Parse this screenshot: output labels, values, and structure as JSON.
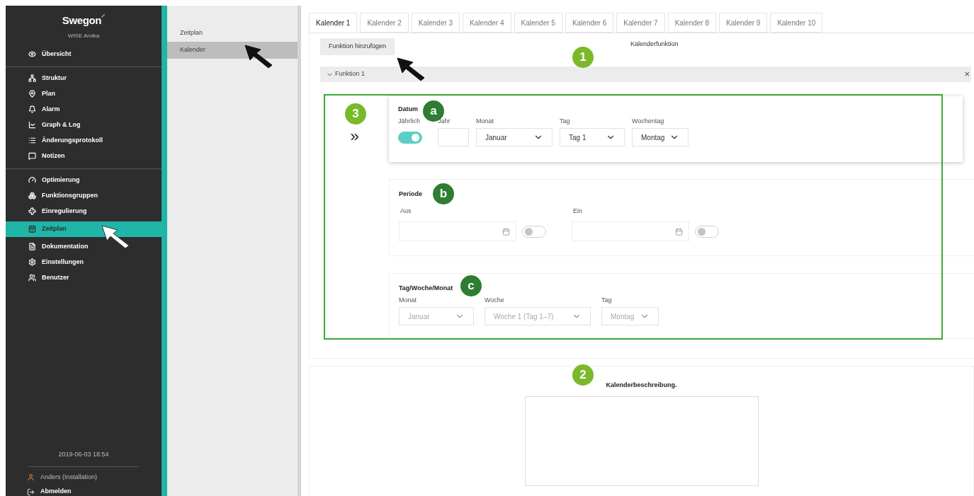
{
  "sidebar": {
    "logo": "Swegon",
    "subtitle": "WISE Arvika",
    "groups": [
      [
        {
          "label": "Übersicht",
          "selected": false
        }
      ],
      [
        {
          "label": "Struktur",
          "selected": false
        },
        {
          "label": "Plan",
          "selected": false
        },
        {
          "label": "Alarm",
          "selected": false
        },
        {
          "label": "Graph & Log",
          "selected": false
        },
        {
          "label": "Änderungsprotokoll",
          "selected": false
        },
        {
          "label": "Notizen",
          "selected": false
        }
      ],
      [
        {
          "label": "Optimierung",
          "selected": false
        },
        {
          "label": "Funktionsgruppen",
          "selected": false
        },
        {
          "label": "Einregulierung",
          "selected": false
        },
        {
          "label": "Zeitplan",
          "selected": true
        },
        {
          "label": "Dokumentation",
          "selected": false
        },
        {
          "label": "Einstellungen",
          "selected": false
        },
        {
          "label": "Benutzer",
          "selected": false
        }
      ]
    ],
    "timestamp": "2019-06-03 18:54",
    "user": "Anders (Installation)",
    "logout": "Abmelden"
  },
  "submenu": [
    {
      "label": "Zeitplan",
      "selected": false
    },
    {
      "label": "Kalender",
      "selected": true
    }
  ],
  "tabs": [
    {
      "label": "Kalender 1",
      "selected": true
    },
    {
      "label": "Kalender 2",
      "selected": false
    },
    {
      "label": "Kalender 3",
      "selected": false
    },
    {
      "label": "Kalender 4",
      "selected": false
    },
    {
      "label": "Kalender 5",
      "selected": false
    },
    {
      "label": "Kalender 6",
      "selected": false
    },
    {
      "label": "Kalender 7",
      "selected": false
    },
    {
      "label": "Kalender 8",
      "selected": false
    },
    {
      "label": "Kalender 9",
      "selected": false
    },
    {
      "label": "Kalender 10",
      "selected": false
    }
  ],
  "add_function_button": "Funktion hinzufügen",
  "section_title": "Kalenderfunktion",
  "function_panel": {
    "title": "Funktion 1",
    "expanded": true,
    "close": "×",
    "expand_marker": "»",
    "datum": {
      "title": "Datum",
      "fields": [
        {
          "kind": "toggle",
          "label": "Jährlich",
          "on": true
        },
        {
          "kind": "input",
          "label": "Jahr"
        },
        {
          "kind": "select",
          "label": "Monat",
          "value": "Januar",
          "disabled": false
        },
        {
          "kind": "select",
          "label": "Tag",
          "value": "Tag 1",
          "disabled": false
        },
        {
          "kind": "select",
          "label": "Wochentag",
          "value": "Montag",
          "disabled": false
        }
      ]
    },
    "periode": {
      "title": "Periode",
      "fields": [
        {
          "label": "Aus",
          "on": false
        },
        {
          "label": "Ein",
          "on": false
        }
      ]
    },
    "tag_woche_monat": {
      "title": "Tag/Woche/Monat",
      "fields": [
        {
          "kind": "select",
          "label": "Monat",
          "value": "Januar",
          "disabled": true
        },
        {
          "kind": "select",
          "label": "Woche",
          "value": "Woche 1 (Tag 1–7)",
          "disabled": true
        },
        {
          "kind": "select",
          "label": "Tag",
          "value": "Montag",
          "disabled": true
        }
      ]
    }
  },
  "description": {
    "title": "Kalenderbeschreibung."
  },
  "callouts": [
    {
      "label": "1",
      "color": "#7ab929"
    },
    {
      "label": "2",
      "color": "#7ab929"
    },
    {
      "label": "3",
      "color": "#7ab929"
    },
    {
      "label": "a",
      "color": "#2e7d32"
    },
    {
      "label": "b",
      "color": "#2e7d32"
    },
    {
      "label": "c",
      "color": "#2e7d32"
    }
  ]
}
